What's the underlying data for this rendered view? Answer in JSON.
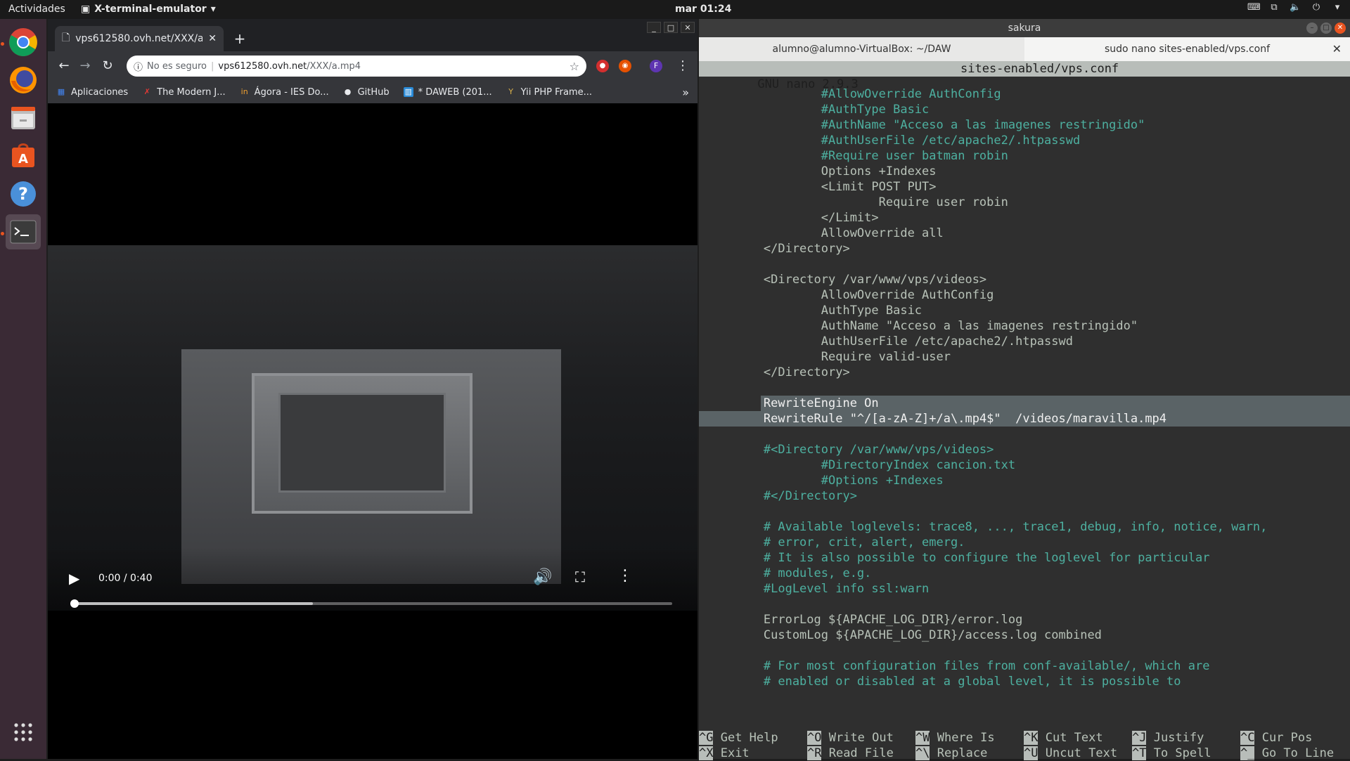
{
  "topbar": {
    "activities": "Actividades",
    "app_menu": "X-terminal-emulator",
    "clock": "mar 01:24"
  },
  "dock": {
    "items": [
      "chrome-icon",
      "firefox-icon",
      "files-icon",
      "software-center-icon",
      "help-icon",
      "terminal-icon"
    ],
    "apps_grid_icon": "app-grid-icon"
  },
  "browser": {
    "tab_title": "vps612580.ovh.net/XXX/a",
    "omnibox": {
      "security": "No es seguro",
      "host": "vps612580.ovh.net",
      "path": "/XXX/a.mp4"
    },
    "bookmarks": [
      {
        "label": "Aplicaciones",
        "icon": "apps-grid-icon",
        "color": "#4285f4"
      },
      {
        "label": "The Modern J...",
        "icon": "x-icon",
        "color": "#e53935"
      },
      {
        "label": "Ágora - IES Do...",
        "icon": "in-icon",
        "color": "#f0a030"
      },
      {
        "label": "GitHub",
        "icon": "github-icon",
        "color": "#e8eaed"
      },
      {
        "label": "* DAWEB (201...",
        "icon": "trello-icon",
        "color": "#2a8bd8"
      },
      {
        "label": "Yii PHP Frame...",
        "icon": "yii-icon",
        "color": "#d9b04a"
      }
    ],
    "video": {
      "time": "0:00 / 0:40",
      "buffered_fraction": 0.4
    }
  },
  "terminal": {
    "window_title": "sakura",
    "tabs": [
      "alumno@alumno-VirtualBox: ~/DAW",
      "sudo nano sites-enabled/vps.conf"
    ],
    "nano_version": "GNU nano 2.9.3",
    "nano_file": "sites-enabled/vps.conf",
    "lines": [
      {
        "text": "        #AllowOverride AuthConfig",
        "style": "comment"
      },
      {
        "text": "        #AuthType Basic",
        "style": "comment"
      },
      {
        "text": "        #AuthName \"Acceso a las imagenes restringido\"",
        "style": "comment"
      },
      {
        "text": "        #AuthUserFile /etc/apache2/.htpasswd",
        "style": "comment"
      },
      {
        "text": "        #Require user batman robin",
        "style": "comment"
      },
      {
        "text": "        Options +Indexes",
        "style": "normal"
      },
      {
        "text": "        <Limit POST PUT>",
        "style": "normal"
      },
      {
        "text": "                Require user robin",
        "style": "normal"
      },
      {
        "text": "        </Limit>",
        "style": "normal"
      },
      {
        "text": "        AllowOverride all",
        "style": "normal"
      },
      {
        "text": "</Directory>",
        "style": "normal"
      },
      {
        "text": "",
        "style": "normal"
      },
      {
        "text": "<Directory /var/www/vps/videos>",
        "style": "normal"
      },
      {
        "text": "        AllowOverride AuthConfig",
        "style": "normal"
      },
      {
        "text": "        AuthType Basic",
        "style": "normal"
      },
      {
        "text": "        AuthName \"Acceso a las imagenes restringido\"",
        "style": "normal"
      },
      {
        "text": "        AuthUserFile /etc/apache2/.htpasswd",
        "style": "normal"
      },
      {
        "text": "        Require valid-user",
        "style": "normal"
      },
      {
        "text": "</Directory>",
        "style": "normal"
      },
      {
        "text": "",
        "style": "normal"
      },
      {
        "text": "RewriteEngine On",
        "style": "sel-part"
      },
      {
        "text": "RewriteRule \"^/[a-zA-Z]+/a\\.mp4$\"  /videos/maravilla.mp4",
        "style": "sel"
      },
      {
        "text": "",
        "style": "normal"
      },
      {
        "text": "#<Directory /var/www/vps/videos>",
        "style": "comment"
      },
      {
        "text": "        #DirectoryIndex cancion.txt",
        "style": "comment"
      },
      {
        "text": "        #Options +Indexes",
        "style": "comment"
      },
      {
        "text": "#</Directory>",
        "style": "comment"
      },
      {
        "text": "",
        "style": "normal"
      },
      {
        "text": "# Available loglevels: trace8, ..., trace1, debug, info, notice, warn,",
        "style": "comment"
      },
      {
        "text": "# error, crit, alert, emerg.",
        "style": "comment"
      },
      {
        "text": "# It is also possible to configure the loglevel for particular",
        "style": "comment"
      },
      {
        "text": "# modules, e.g.",
        "style": "comment"
      },
      {
        "text": "#LogLevel info ssl:warn",
        "style": "comment"
      },
      {
        "text": "",
        "style": "normal"
      },
      {
        "text": "ErrorLog ${APACHE_LOG_DIR}/error.log",
        "style": "normal"
      },
      {
        "text": "CustomLog ${APACHE_LOG_DIR}/access.log combined",
        "style": "normal"
      },
      {
        "text": "",
        "style": "normal"
      },
      {
        "text": "# For most configuration files from conf-available/, which are",
        "style": "comment"
      },
      {
        "text": "# enabled or disabled at a global level, it is possible to",
        "style": "comment"
      }
    ],
    "shortcuts": [
      [
        {
          "k": "^G",
          "l": "Get Help"
        },
        {
          "k": "^O",
          "l": "Write Out"
        },
        {
          "k": "^W",
          "l": "Where Is"
        },
        {
          "k": "^K",
          "l": "Cut Text"
        },
        {
          "k": "^J",
          "l": "Justify"
        },
        {
          "k": "^C",
          "l": "Cur Pos"
        }
      ],
      [
        {
          "k": "^X",
          "l": "Exit"
        },
        {
          "k": "^R",
          "l": "Read File"
        },
        {
          "k": "^\\",
          "l": "Replace"
        },
        {
          "k": "^U",
          "l": "Uncut Text"
        },
        {
          "k": "^T",
          "l": "To Spell"
        },
        {
          "k": "^_",
          "l": "Go To Line"
        }
      ]
    ]
  }
}
